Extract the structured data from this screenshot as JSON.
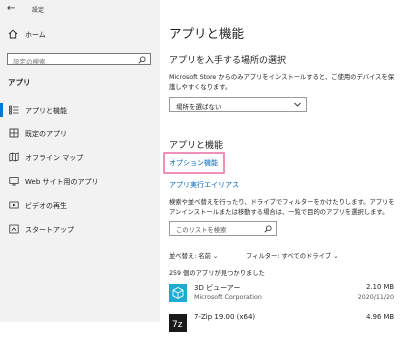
{
  "window": {
    "title": "設定"
  },
  "sidebar": {
    "home_label": "ホーム",
    "search_placeholder": "設定の検索",
    "section_title": "アプリ",
    "items": [
      {
        "label": "アプリと機能",
        "icon": "list-icon",
        "active": true
      },
      {
        "label": "既定のアプリ",
        "icon": "default-apps-icon"
      },
      {
        "label": "オフライン マップ",
        "icon": "map-icon"
      },
      {
        "label": "Web サイト用のアプリ",
        "icon": "web-app-icon"
      },
      {
        "label": "ビデオの再生",
        "icon": "video-icon"
      },
      {
        "label": "スタートアップ",
        "icon": "startup-icon"
      }
    ]
  },
  "main": {
    "page_title": "アプリと機能",
    "source_heading": "アプリを入手する場所の選択",
    "source_description": "Microsoft Store からのみアプリをインストールすると、ご使用のデバイスを保護しやすくなります。",
    "source_dropdown_value": "場所を選ばない",
    "features_heading": "アプリと機能",
    "optional_features_link": "オプション機能",
    "app_aliases_link": "アプリ実行エイリアス",
    "search_description": "検索や並べ替えを行ったり、ドライブでフィルターをかけたりします。アプリをアンインストールまたは移動する場合は、一覧で目的のアプリを選択します。",
    "list_search_placeholder": "このリストを検索",
    "sort_label": "並べ替え:",
    "sort_value": "名前",
    "filter_label": "フィルター:",
    "filter_value": "すべてのドライブ",
    "apps_count": "259 個のアプリが見つかりました",
    "apps": [
      {
        "name": "3D ビューアー",
        "publisher": "Microsoft Corporation",
        "size": "2.10 MB",
        "date": "2020/11/20"
      },
      {
        "name": "7-Zip 19.00 (x64)",
        "publisher": "",
        "size": "4.96 MB",
        "date": ""
      }
    ]
  },
  "colors": {
    "accent": "#0078d4",
    "link": "#0067b8",
    "highlight": "#f08fb8"
  }
}
